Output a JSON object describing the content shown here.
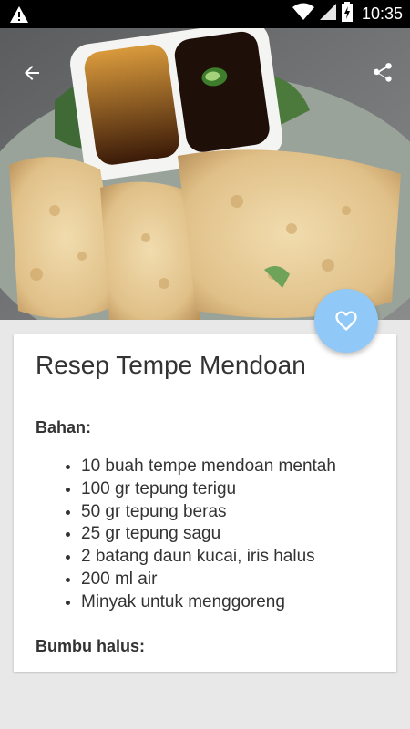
{
  "status_bar": {
    "time": "10:35",
    "icons": [
      "warning-icon",
      "wifi-icon",
      "signal-icon",
      "battery-charging-icon"
    ]
  },
  "toolbar": {
    "back_icon": "arrow-back-icon",
    "share_icon": "share-icon"
  },
  "fab": {
    "icon": "heart-outline-icon",
    "color": "#90c8f8"
  },
  "recipe": {
    "title": "Resep Tempe Mendoan",
    "bahan_heading": "Bahan:",
    "bahan": [
      "10 buah tempe mendoan mentah",
      "100 gr tepung terigu",
      "50 gr tepung beras",
      "25 gr tepung sagu",
      "2 batang daun kucai, iris halus",
      "200 ml air",
      "Minyak untuk menggoreng"
    ],
    "bumbu_heading": "Bumbu halus:"
  }
}
